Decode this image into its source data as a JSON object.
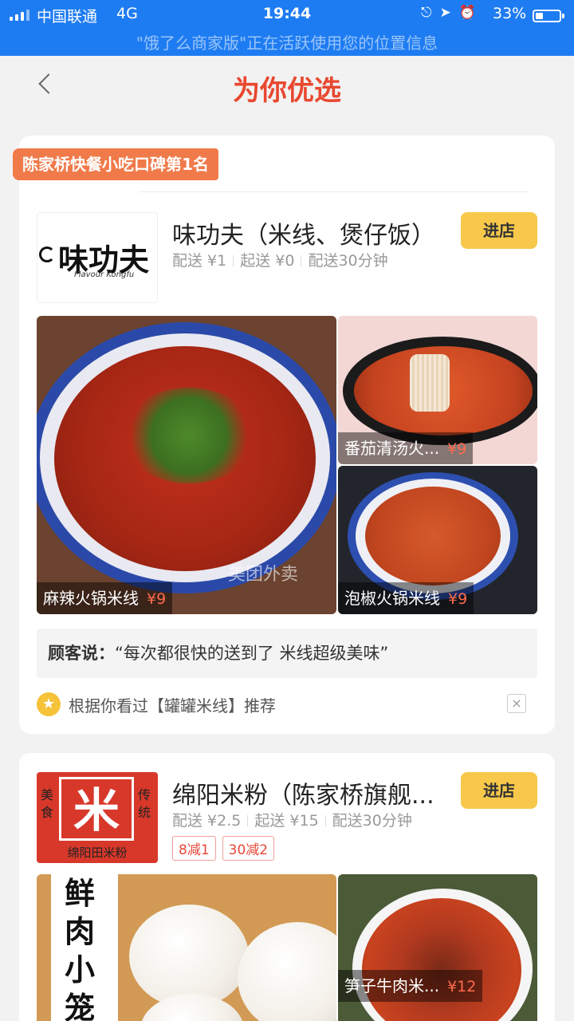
{
  "status_bar": {
    "carrier": "中国联通",
    "network": "4G",
    "time": "19:44",
    "icons": [
      "lock-rotation-icon",
      "location-arrow-icon",
      "alarm-icon"
    ],
    "battery_text": "33%",
    "battery_level": 0.33,
    "location_notice": "\"饿了么商家版\"正在活跃使用您的位置信息"
  },
  "nav": {
    "title": "为你优选"
  },
  "cards": [
    {
      "rank_badge": "陈家桥快餐小吃口碑第1名",
      "logo": {
        "main": "味功夫",
        "sub": "Flavour Kongfu"
      },
      "name": "味功夫（米线、煲仔饭）",
      "meta": {
        "delivery_fee": "配送 ¥1",
        "min_order": "起送 ¥0",
        "time": "配送30分钟"
      },
      "enter_label": "进店",
      "dishes": [
        {
          "name": "麻辣火锅米线",
          "price": "¥9"
        },
        {
          "name": "番茄清汤火...",
          "price": "¥9"
        },
        {
          "name": "泡椒火锅米线",
          "price": "¥9"
        }
      ],
      "watermark": "美团外卖",
      "review": {
        "who": "顾客说：",
        "text": "“每次都很快的送到了 米线超级美味”"
      },
      "recommend": "根据你看过【罐罐米线】推荐",
      "close_icon": "×"
    },
    {
      "logo": {
        "main": "米",
        "left": "美食",
        "right": "传统",
        "bottom": "绵阳田米粉"
      },
      "name": "绵阳米粉（陈家桥旗舰...",
      "meta": {
        "delivery_fee": "配送 ¥2.5",
        "min_order": "起送 ¥15",
        "time": "配送30分钟"
      },
      "promo_tags": [
        "8减1",
        "30减2"
      ],
      "enter_label": "进店",
      "big_image_text": "鲜肉小笼包",
      "dishes": [
        {
          "name": "笋子牛肉米...",
          "price": "¥12"
        }
      ]
    }
  ],
  "colors": {
    "status_bar": "#1e7cf2",
    "title_red": "#e8482f",
    "badge_orange": "#f07a4a",
    "enter_yellow": "#f7c84a",
    "price_red": "#ff6a4c"
  }
}
